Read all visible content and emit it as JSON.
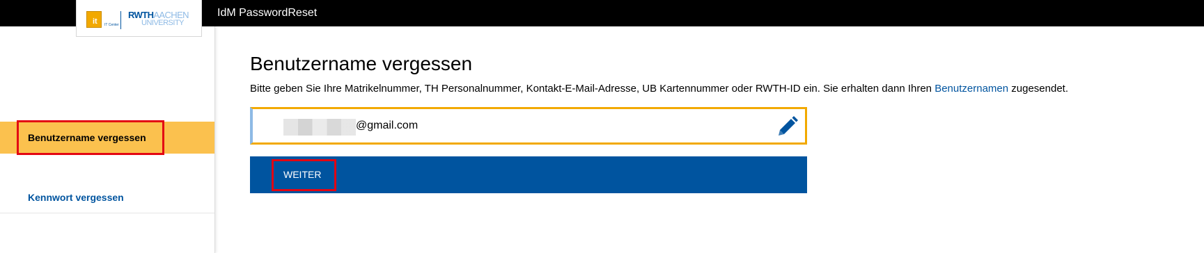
{
  "header": {
    "app_title": "IdM PasswordReset",
    "logo": {
      "it_mark": "it",
      "it_center": "IT Center",
      "rwth": "RWTH",
      "aachen": "AACHEN",
      "university": "UNIVERSITY"
    }
  },
  "sidebar": {
    "items": [
      {
        "label": "Benutzername vergessen",
        "active": true
      },
      {
        "label": "Kennwort vergessen",
        "active": false
      }
    ]
  },
  "main": {
    "title": "Benutzername vergessen",
    "description_prefix": "Bitte geben Sie Ihre Matrikelnummer, TH Personalnummer, Kontakt-E-Mail-Adresse, UB Kartennummer oder RWTH-ID ein. Sie erhalten dann Ihren ",
    "description_link": "Benutzernamen",
    "description_suffix": " zugesendet.",
    "input_value": "@gmail.com",
    "submit_label": "WEITER"
  },
  "colors": {
    "brand_blue": "#00549f",
    "active_nav": "#fbc14e",
    "input_border": "#f2a900",
    "highlight": "#e30613"
  }
}
